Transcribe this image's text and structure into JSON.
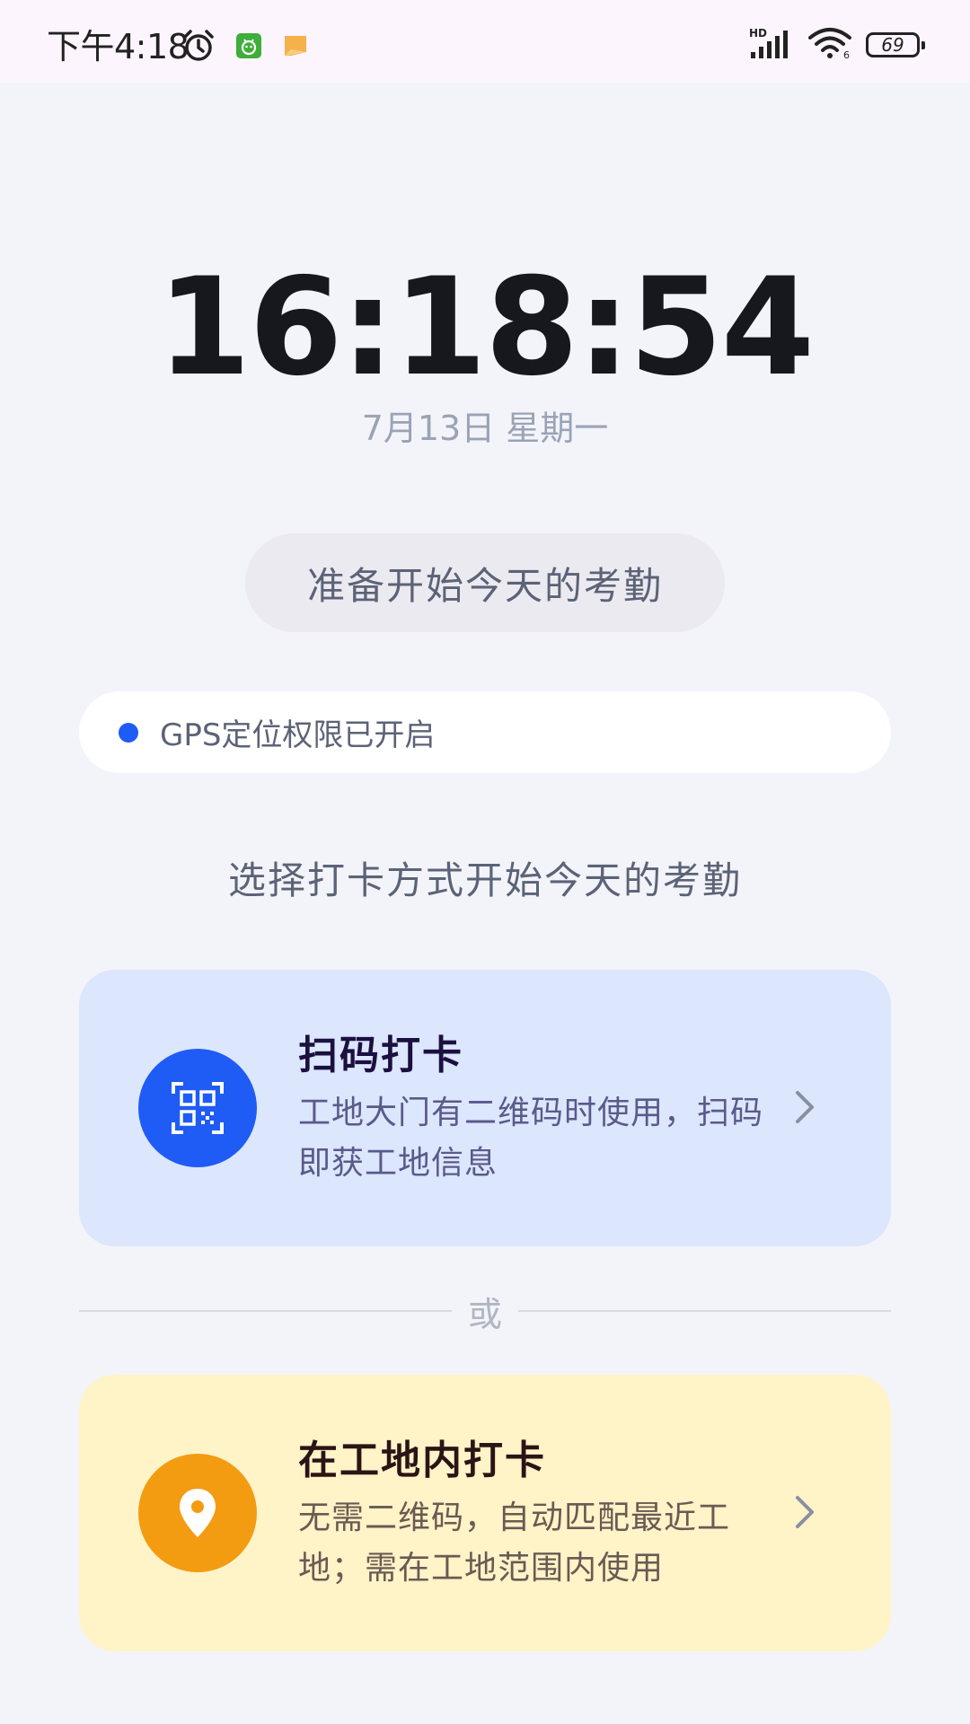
{
  "status_bar": {
    "time": "下午4:18",
    "left_icons": [
      "alarm-clock-icon",
      "app-android-icon",
      "message-flag-icon"
    ],
    "right_icons": [
      "hd-signal-icon",
      "wifi-icon"
    ],
    "battery_level": "69"
  },
  "clock": {
    "time": "16:18:54",
    "date": "7月13日 星期一"
  },
  "attendance": {
    "status": "准备开始今天的考勤"
  },
  "gps": {
    "text": "GPS定位权限已开启"
  },
  "prompt": {
    "title": "选择打卡方式开始今天的考勤"
  },
  "options": [
    {
      "title": "扫码打卡",
      "description": "工地大门有二维码时使用，扫码即获工地信息",
      "icon": "qr-code-icon"
    },
    {
      "title": "在工地内打卡",
      "description": "无需二维码，自动匹配最近工地；需在工地范围内使用",
      "icon": "location-pin-icon"
    }
  ],
  "divider": {
    "text": "或"
  },
  "colors": {
    "primary_blue": "#1f5cf5",
    "qr_card_bg": "#dce6fd",
    "site_orange": "#f39c12",
    "site_card_bg": "#fff3c8",
    "background": "#f3f4f9"
  }
}
